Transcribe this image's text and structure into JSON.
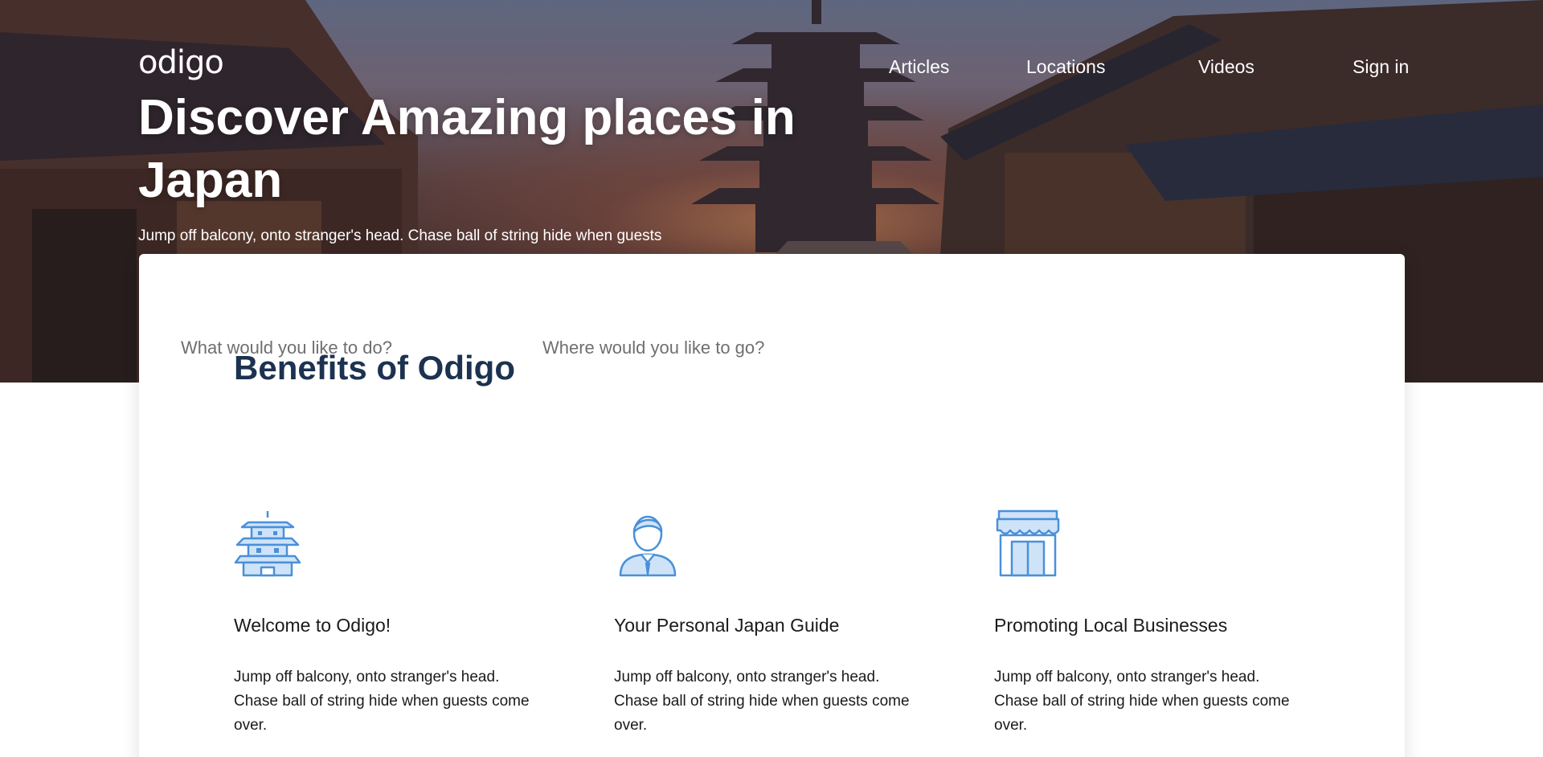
{
  "header": {
    "logo": "odigo",
    "nav": [
      {
        "label": "Articles"
      },
      {
        "label": "Locations"
      },
      {
        "label": "Videos"
      },
      {
        "label": "Sign in"
      }
    ]
  },
  "hero": {
    "title": "Discover Amazing places in Japan",
    "subtitle": "Jump off balcony, onto stranger's head. Chase ball of string hide when guests"
  },
  "search": {
    "activity_placeholder": "What would you like to do?",
    "location_placeholder": "Where would you like to go?"
  },
  "benefits": {
    "title": "Benefits of Odigo",
    "items": [
      {
        "icon": "pagoda-icon",
        "title": "Welcome to Odigo!",
        "text": "Jump off balcony, onto stranger's head. Chase ball of string hide when guests come over."
      },
      {
        "icon": "person-icon",
        "title": "Your Personal Japan Guide",
        "text": "Jump off balcony, onto stranger's head. Chase ball of string hide when guests come over."
      },
      {
        "icon": "storefront-icon",
        "title": "Promoting Local Businesses",
        "text": "Jump off balcony, onto stranger's head. Chase ball of string hide when guests come over."
      }
    ]
  },
  "colors": {
    "accent": "#1c3251",
    "icon_stroke": "#4a90d9",
    "icon_fill": "#cfe3f8"
  }
}
